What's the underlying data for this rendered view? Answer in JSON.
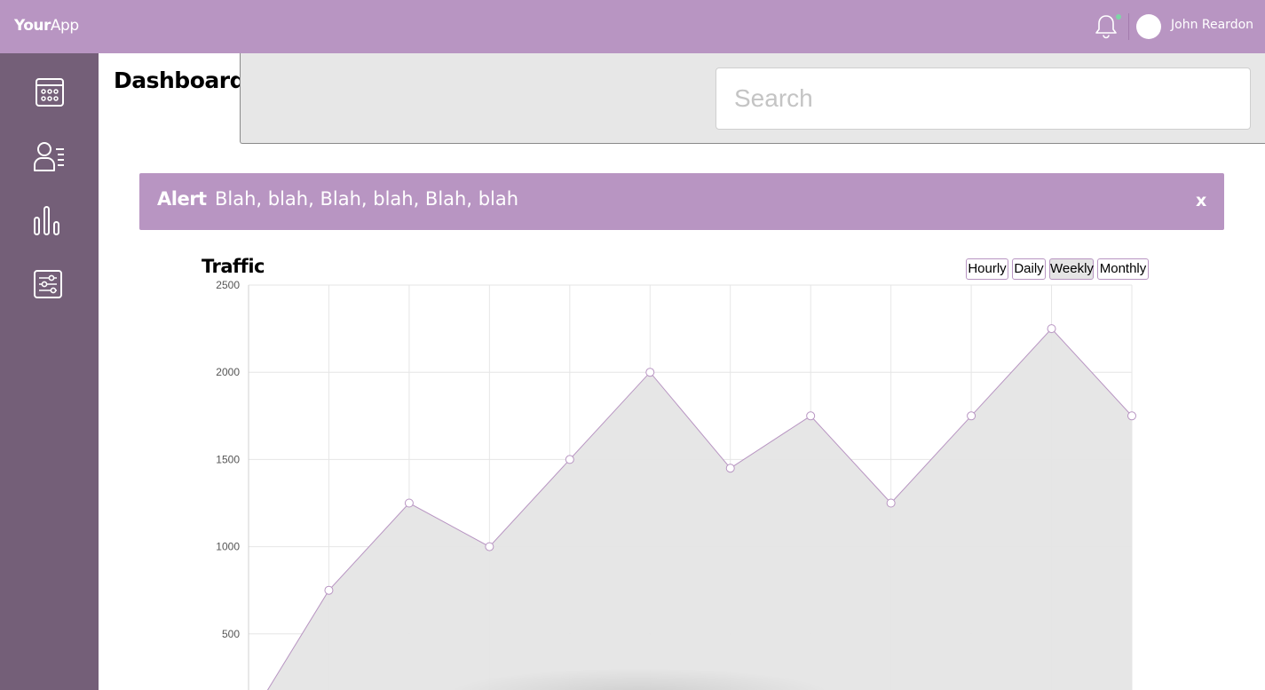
{
  "app": {
    "logo_bold": "Your",
    "logo_rest": "App"
  },
  "user": {
    "name": "John Reardon"
  },
  "page": {
    "title": "Dashboard"
  },
  "search": {
    "placeholder": "Search"
  },
  "alert": {
    "label": "Alert",
    "message": "Blah, blah, Blah, blah, Blah, blah",
    "close": "x"
  },
  "sidebar": {
    "items": [
      {
        "icon": "calendar-icon"
      },
      {
        "icon": "users-icon"
      },
      {
        "icon": "bar-chart-icon"
      },
      {
        "icon": "settings-sliders-icon"
      }
    ]
  },
  "colors": {
    "brand": "#b895c2",
    "sidebar": "#745f78",
    "notification_dot": "#7ed6a6"
  },
  "traffic": {
    "title": "Traffic",
    "filters": [
      "Hourly",
      "Daily",
      "Weekly",
      "Monthly"
    ],
    "active_filter": "Weekly"
  },
  "chart_data": {
    "type": "area",
    "title": "Traffic",
    "x": [
      0,
      1,
      2,
      3,
      4,
      5,
      6,
      7,
      8,
      9,
      10,
      11
    ],
    "values": [
      0,
      750,
      1250,
      1000,
      1500,
      2000,
      1450,
      1750,
      1250,
      1750,
      2250,
      1750
    ],
    "y_ticks": [
      500,
      1000,
      1500,
      2000,
      2500
    ],
    "ylim": [
      0,
      2500
    ],
    "grid": true,
    "colors": {
      "fill": "#e5e5e5",
      "line": "#b895c2",
      "point_stroke": "#b895c2",
      "grid": "#e6e6e6",
      "tick_text": "#555555"
    }
  }
}
